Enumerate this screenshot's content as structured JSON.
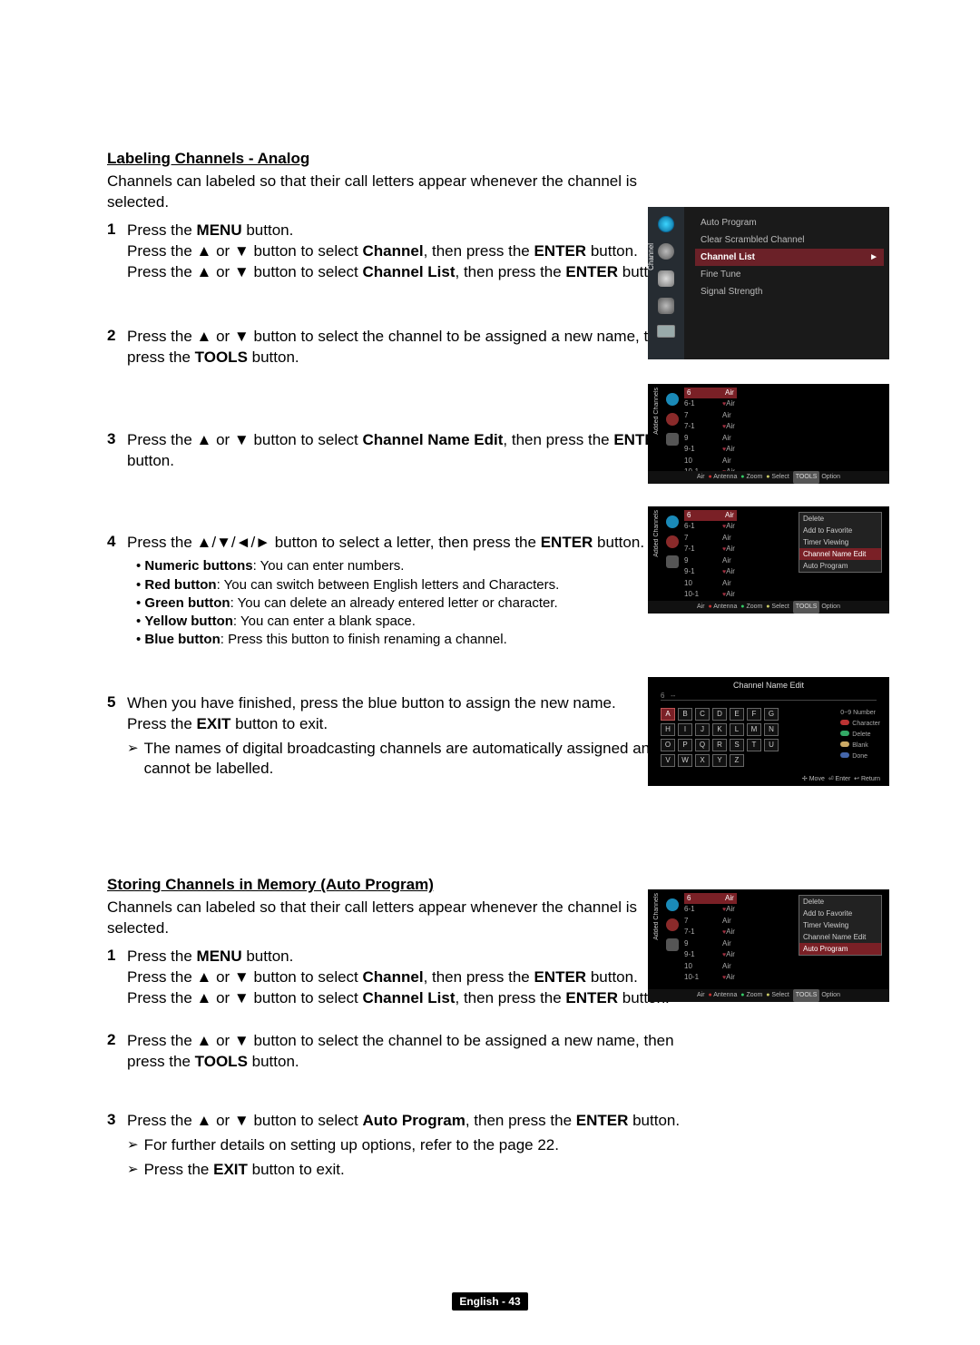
{
  "section1": {
    "title": "Labeling Channels - Analog",
    "intro": "Channels can labeled so that their call letters appear whenever the channel is selected.",
    "steps": {
      "1": {
        "l1a": "Press the ",
        "l1b": "MENU",
        "l1c": " button.",
        "l2a": "Press the ▲ or ▼ button to select ",
        "l2b": "Channel",
        "l2c": ", then press the ",
        "l2d": "ENTER",
        "l2e": " button.",
        "l3a": "Press the ▲ or ▼ button to select ",
        "l3b": "Channel List",
        "l3c": ", then press the ",
        "l3d": "ENTER",
        "l3e": " button."
      },
      "2": {
        "a": "Press the ▲ or ▼ button to select the channel to be assigned a new name, then press the ",
        "b": "TOOLS",
        "c": " button."
      },
      "3": {
        "a": "Press the ▲ or ▼ button to select ",
        "b": "Channel Name Edit",
        "c": ", then press the ",
        "d": "ENTER",
        "e": " button."
      },
      "4": {
        "a": "Press the ▲/▼/◄/► button to select a letter, then press the ",
        "b": "ENTER",
        "c": " button.",
        "bullets": {
          "n1b": "Numeric buttons",
          "n1t": ": You can enter numbers.",
          "n2b": "Red button",
          "n2t": ": You can switch between English letters and Characters.",
          "n3b": "Green button",
          "n3t": ": You can delete an already entered letter or character.",
          "n4b": "Yellow button",
          "n4t": ": You can enter a blank space.",
          "n5b": "Blue button",
          "n5t": ": Press this button to finish renaming a channel."
        }
      },
      "5": {
        "a": "When you have finished, press the blue button to assign the new name.",
        "b1": "Press the ",
        "b2": "EXIT",
        "b3": " button to exit.",
        "note": "The names of digital broadcasting channels are automatically assigned and cannot be labelled."
      }
    }
  },
  "section2": {
    "title": "Storing Channels in Memory (Auto Program)",
    "intro": "Channels can labeled so that their call letters appear whenever the channel is selected.",
    "steps": {
      "1": {
        "l1a": "Press the ",
        "l1b": "MENU",
        "l1c": " button.",
        "l2a": "Press the ▲ or ▼ button to select ",
        "l2b": "Channel",
        "l2c": ", then press the ",
        "l2d": "ENTER",
        "l2e": " button.",
        "l3a": "Press the ▲ or ▼ button to select ",
        "l3b": "Channel List",
        "l3c": ", then press the ",
        "l3d": "ENTER",
        "l3e": " button."
      },
      "2": {
        "a": "Press the ▲ or ▼ button to select the channel to be assigned a new name, then press the ",
        "b": "TOOLS",
        "c": " button."
      },
      "3": {
        "a": "Press the ▲ or ▼ button to select ",
        "b": "Auto Program",
        "c": ", then press the ",
        "d": "ENTER",
        "e": " button.",
        "note1": "For further details on setting up options, refer to the page 22.",
        "note2a": "Press the ",
        "note2b": "EXIT",
        "note2c": " button to exit."
      }
    }
  },
  "footer": {
    "text": "English - 43"
  },
  "thumb1": {
    "vlabel": "Channel",
    "items": [
      "Auto Program",
      "Clear Scrambled Channel",
      "Channel List",
      "Fine Tune",
      "Signal Strength"
    ]
  },
  "channel_rows": [
    {
      "n": "6",
      "t": "Air",
      "sel": true
    },
    {
      "n": "6-1",
      "t": "Air",
      "h": true
    },
    {
      "n": "7",
      "t": "Air"
    },
    {
      "n": "7-1",
      "t": "Air",
      "h": true
    },
    {
      "n": "9",
      "t": "Air"
    },
    {
      "n": "9-1",
      "t": "Air",
      "h": true
    },
    {
      "n": "10",
      "t": "Air"
    },
    {
      "n": "10-1",
      "t": "Air",
      "h": true
    }
  ],
  "side_tab": "Added Channels",
  "cl_footer": {
    "air": "Air",
    "ant": "Antenna",
    "zoom": "Zoom",
    "sel": "Select",
    "opt": "Option",
    "tools": "TOOLS"
  },
  "popup3": [
    "Delete",
    "Add to Favorite",
    "Timer Viewing",
    "Channel Name Edit",
    "Auto Program"
  ],
  "popup3_hl": 3,
  "popup5_hl": 4,
  "thumb4": {
    "title": "Channel Name Edit",
    "ch": "6",
    "letters": [
      "A",
      "B",
      "C",
      "D",
      "E",
      "F",
      "G",
      "H",
      "I",
      "J",
      "K",
      "L",
      "M",
      "N",
      "O",
      "P",
      "Q",
      "R",
      "S",
      "T",
      "U",
      "V",
      "W",
      "X",
      "Y",
      "Z"
    ],
    "legend": {
      "num": "Number",
      "char": "Character",
      "del": "Delete",
      "blank": "Blank",
      "done": "Done",
      "numkey": "0~9"
    },
    "footer": {
      "move": "Move",
      "enter": "Enter",
      "ret": "Return"
    }
  }
}
